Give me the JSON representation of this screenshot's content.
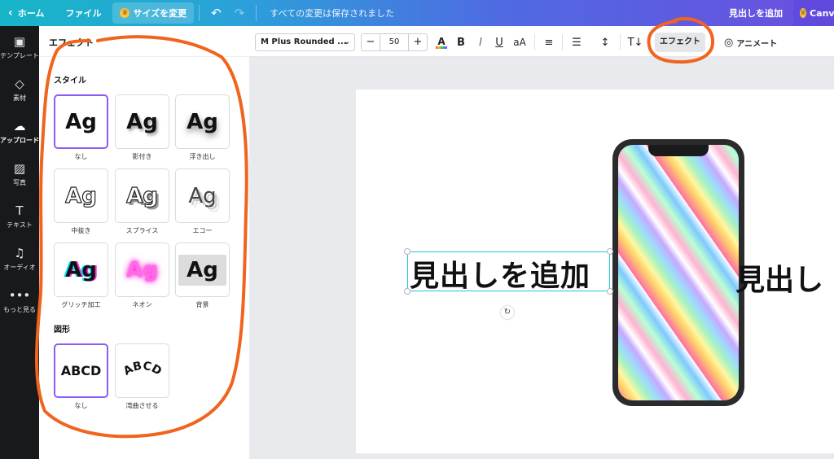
{
  "topbar": {
    "home": "ホーム",
    "file": "ファイル",
    "resize": "サイズを変更",
    "saved_status": "すべての変更は保存されました",
    "add_heading": "見出しを追加",
    "canva_pro": "Canva"
  },
  "leftnav": {
    "items": [
      {
        "label": "テンプレート",
        "icon": "template-icon"
      },
      {
        "label": "素材",
        "icon": "elements-icon"
      },
      {
        "label": "アップロード",
        "icon": "upload-cloud-icon"
      },
      {
        "label": "写真",
        "icon": "photo-icon"
      },
      {
        "label": "テキスト",
        "icon": "text-icon"
      },
      {
        "label": "オーディオ",
        "icon": "music-note-icon"
      },
      {
        "label": "もっと見る",
        "icon": "more-dots-icon"
      }
    ]
  },
  "panel": {
    "title": "エフェクト",
    "style_section": "スタイル",
    "styles": [
      {
        "label": "なし",
        "preview": "Ag"
      },
      {
        "label": "影付き",
        "preview": "Ag"
      },
      {
        "label": "浮き出し",
        "preview": "Ag"
      },
      {
        "label": "中抜き",
        "preview": "Ag"
      },
      {
        "label": "スプライス",
        "preview": "Ag"
      },
      {
        "label": "エコー",
        "preview": "Ag"
      },
      {
        "label": "グリッチ加工",
        "preview": "Ag"
      },
      {
        "label": "ネオン",
        "preview": "Ag"
      },
      {
        "label": "背景",
        "preview": "Ag"
      }
    ],
    "shape_section": "図形",
    "shapes": [
      {
        "label": "なし",
        "preview": "ABCD"
      },
      {
        "label": "湾曲させる",
        "preview": "ABCD"
      }
    ]
  },
  "toolbar": {
    "font": "M Plus Rounded ...",
    "font_size": "50",
    "minus": "−",
    "plus": "+",
    "effects": "エフェクト",
    "animate": "アニメート"
  },
  "canvas": {
    "heading_text": "見出しを追加",
    "heading_text_2": "見出し"
  },
  "colors": {
    "annotation": "#f0641e",
    "selected_border": "#8b5cf6",
    "selection_box": "#19c7de"
  }
}
